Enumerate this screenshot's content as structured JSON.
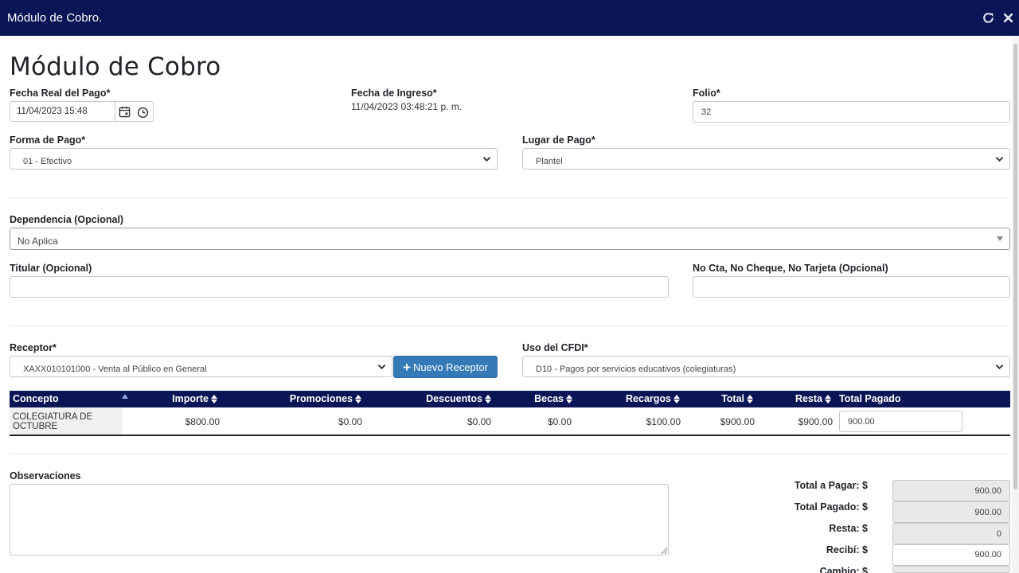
{
  "window": {
    "title": "Módulo de Cobro.",
    "refresh_icon": "refresh-icon",
    "close_icon": "close-icon"
  },
  "page": {
    "title": "Módulo de Cobro"
  },
  "fields": {
    "fecha_real": {
      "label": "Fecha Real del Pago*",
      "value": "11/04/2023 15:48"
    },
    "fecha_ingreso": {
      "label": "Fecha de Ingreso*",
      "value": "11/04/2023 03:48:21 p. m."
    },
    "folio": {
      "label": "Folio*",
      "value": "32"
    },
    "forma_pago": {
      "label": "Forma de Pago*",
      "value": "01 - Efectivo"
    },
    "lugar_pago": {
      "label": "Lugar de Pago*",
      "value": "Plantel"
    },
    "dependencia": {
      "label": "Dependencia (Opcional)",
      "value": "No Aplica"
    },
    "titular": {
      "label": "Titular (Opcional)",
      "value": ""
    },
    "no_cta": {
      "label": "No Cta, No Cheque, No Tarjeta (Opcional)",
      "value": ""
    },
    "receptor": {
      "label": "Receptor*",
      "value": "XAXX010101000 - Venta al Público en General"
    },
    "nuevo_receptor": {
      "label": "Nuevo Receptor"
    },
    "uso_cfdi": {
      "label": "Uso del CFDI*",
      "value": "D10 - Pagos por servicios educativos (colegiaturas)"
    }
  },
  "grid": {
    "columns": [
      "Concepto",
      "Importe",
      "Promociones",
      "Descuentos",
      "Becas",
      "Recargos",
      "Total",
      "Resta",
      "Total Pagado"
    ],
    "rows": [
      {
        "concepto": "COLEGIATURA DE OCTUBRE",
        "importe": "$800.00",
        "promociones": "$0.00",
        "descuentos": "$0.00",
        "becas": "$0.00",
        "recargos": "$100.00",
        "total": "$900.00",
        "resta": "$900.00",
        "total_pagado": "900.00"
      }
    ]
  },
  "observaciones": {
    "label": "Observaciones",
    "value": ""
  },
  "totales": {
    "total_a_pagar": {
      "label": "Total a Pagar: $",
      "value": "900.00"
    },
    "total_pagado": {
      "label": "Total Pagado: $",
      "value": "900.00"
    },
    "resta": {
      "label": "Resta: $",
      "value": "0"
    },
    "recibi": {
      "label": "Recibí: $",
      "value": "900.00"
    },
    "cambio": {
      "label": "Cambio: $",
      "value": ""
    }
  },
  "colors": {
    "header_bg": "#0a1556",
    "primary_button": "#337ab7"
  }
}
